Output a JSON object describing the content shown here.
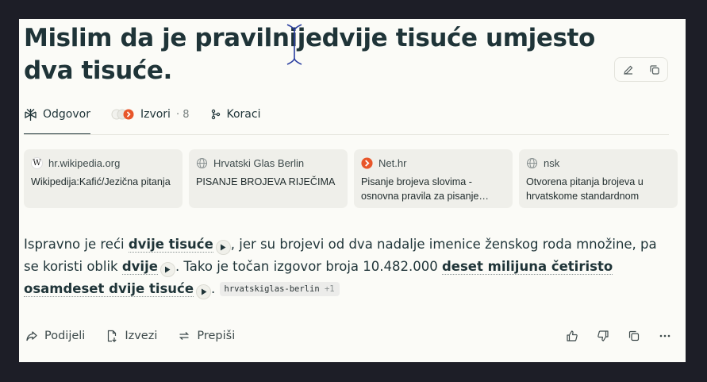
{
  "query": {
    "text": "Mislim da je pravilnijedvije tisuće umjesto dva tisuće."
  },
  "tabs": [
    {
      "label": "Odgovor",
      "icon": "perplexity-icon"
    },
    {
      "label": "Izvori",
      "count": "· 8",
      "icon": "sources-icon"
    },
    {
      "label": "Koraci",
      "icon": "steps-icon"
    }
  ],
  "sources": [
    {
      "site": "hr.wikipedia.org",
      "favicon": "W",
      "title": "Wikipedija:Kafić/Jezična pitanja"
    },
    {
      "site": "Hrvatski Glas Berlin",
      "favicon": "globe",
      "title": "PISANJE BROJEVA RIJEČIMA"
    },
    {
      "site": "Net.hr",
      "favicon": "net",
      "title": "Pisanje brojeva slovima - osnovna pravila za pisanje…"
    },
    {
      "site": "nsk",
      "favicon": "globe",
      "title": "Otvorena pitanja brojeva u hrvatskome standardnom"
    }
  ],
  "answer": {
    "p1": "Ispravno je reći ",
    "h1": "dvije tisuće",
    "p2": ", jer su brojevi od dva nadalje imenice ženskog roda množine, pa se koristi oblik ",
    "h2": "dvije",
    "p3": ". Tako je točan izgovor broja 10.482.000 ",
    "h3": "deset milijuna četiristo osamdeset dvije tisuće",
    "p4": ".",
    "citation": "hrvatskiglas-berlin",
    "citation_extra": "+1"
  },
  "footer": {
    "share": "Podijeli",
    "export": "Izvezi",
    "rewrite": "Prepiši"
  },
  "colors": {
    "background": "#1d1e27",
    "panel": "#fbfbf7",
    "text": "#1f3438",
    "card": "#efefea",
    "accent": "#e8562a"
  }
}
